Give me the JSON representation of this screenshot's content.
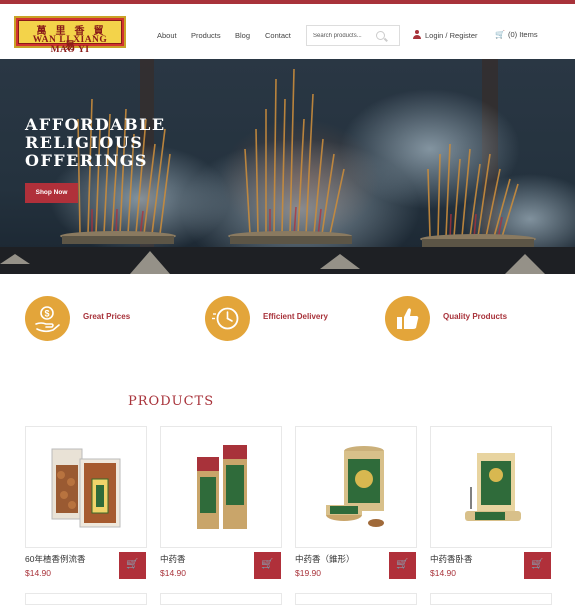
{
  "brand": {
    "logo_cn": "萬里香貿易",
    "logo_en": "WAN LI XIANG MAO YI"
  },
  "nav": {
    "about": "About",
    "products": "Products",
    "blog": "Blog",
    "contact": "Contact"
  },
  "search": {
    "placeholder": "Search products..."
  },
  "account": {
    "login": "Login / Register",
    "cart": "(0) Items"
  },
  "hero": {
    "title": "AFFORDABLE\nRELIGIOUS\nOFFERINGS",
    "button": "Shop Now"
  },
  "features": [
    {
      "label": "Great Prices",
      "icon": "hand-dollar-icon"
    },
    {
      "label": "Efficient Delivery",
      "icon": "clock-icon"
    },
    {
      "label": "Quality Products",
      "icon": "thumbs-up-icon"
    }
  ],
  "products_section": {
    "title": "PRODUCTS"
  },
  "products": [
    {
      "name": "60年楂香例流香",
      "price": "$14.90"
    },
    {
      "name": "中药香",
      "price": "$14.90"
    },
    {
      "name": "中药香（錐形）",
      "price": "$19.90"
    },
    {
      "name": "中药香卧香",
      "price": "$14.90"
    }
  ],
  "colors": {
    "accent": "#a8323a",
    "feature_icon": "#e3a53a"
  }
}
